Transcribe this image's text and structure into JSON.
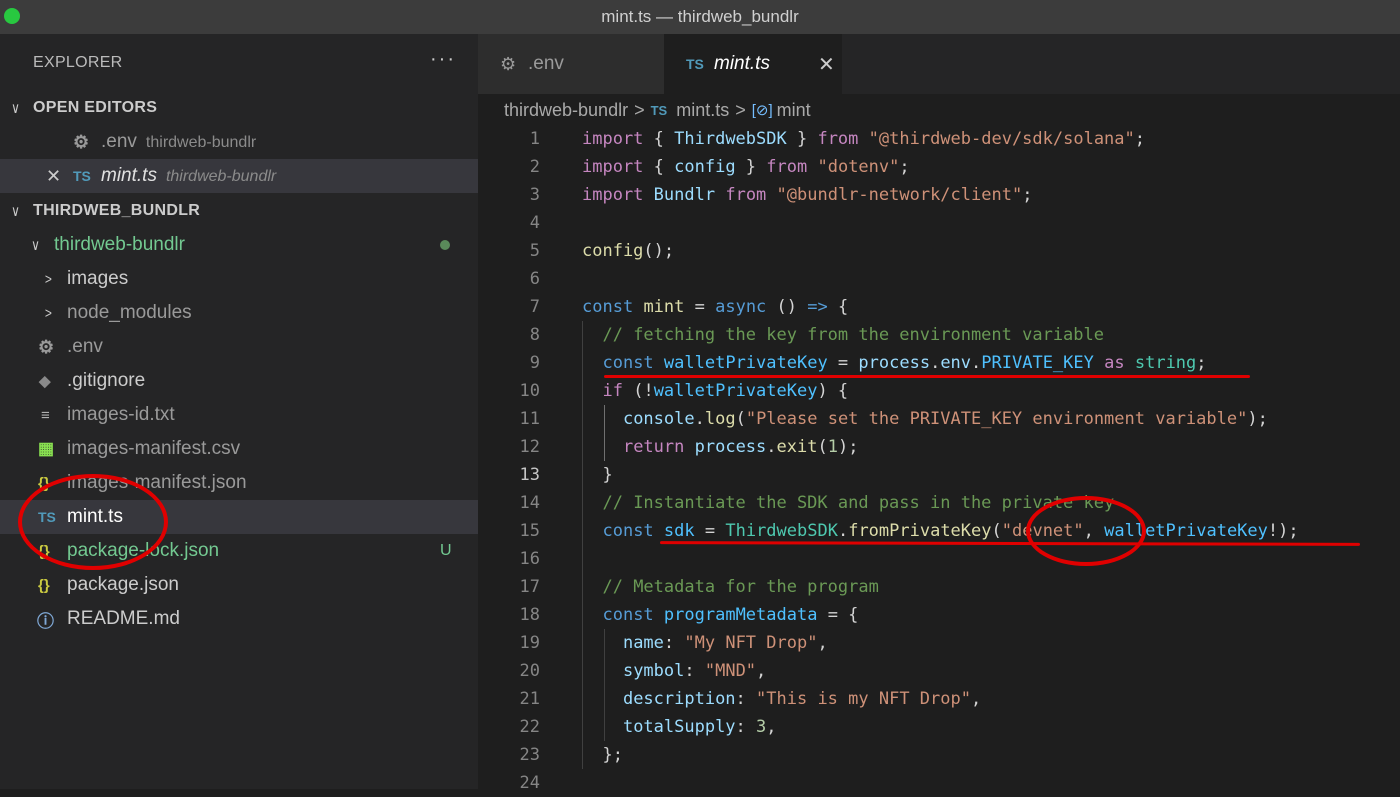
{
  "window": {
    "title": "mint.ts — thirdweb_bundlr"
  },
  "explorer": {
    "title": "EXPLORER",
    "more": "···",
    "open_editors": {
      "title": "OPEN EDITORS",
      "items": [
        {
          "icon": "gear-icon",
          "name": ".env",
          "path": "thirdweb-bundlr"
        },
        {
          "icon": "ts-icon",
          "icon_text": "TS",
          "name": "mint.ts",
          "path": "thirdweb-bundlr",
          "close": "✕"
        }
      ]
    },
    "workspace": {
      "title": "THIRDWEB_BUNDLR",
      "folder": "thirdweb-bundlr",
      "items": [
        {
          "name": "images",
          "kind": "folder"
        },
        {
          "name": "node_modules",
          "kind": "folder"
        },
        {
          "name": ".env",
          "icon": "gear-icon"
        },
        {
          "name": ".gitignore",
          "icon": "git-icon"
        },
        {
          "name": "images-id.txt",
          "icon": "lines-icon"
        },
        {
          "name": "images-manifest.csv",
          "icon": "csv-icon"
        },
        {
          "name": "images-manifest.json",
          "icon": "json-icon",
          "icon_text": "{}"
        },
        {
          "name": "mint.ts",
          "icon": "ts-icon",
          "icon_text": "TS"
        },
        {
          "name": "package-lock.json",
          "icon": "json-icon",
          "icon_text": "{}",
          "badge": "U"
        },
        {
          "name": "package.json",
          "icon": "json-icon",
          "icon_text": "{}"
        },
        {
          "name": "README.md",
          "icon": "info-icon"
        }
      ]
    }
  },
  "tabs": [
    {
      "label": ".env",
      "icon": "gear-icon"
    },
    {
      "label": "mint.ts",
      "icon": "ts-icon",
      "icon_text": "TS",
      "close": "✕",
      "active": true
    }
  ],
  "breadcrumb": {
    "folder": "thirdweb-bundlr",
    "file": "mint.ts",
    "file_icon": "TS",
    "symbol": "mint",
    "separator": ">"
  },
  "editor": {
    "current_line": 13,
    "lines": [
      [
        [
          "kw",
          "import"
        ],
        [
          "p",
          " { "
        ],
        [
          "vr",
          "ThirdwebSDK"
        ],
        [
          "p",
          " } "
        ],
        [
          "kw",
          "from"
        ],
        [
          "p",
          " "
        ],
        [
          "st",
          "\"@thirdweb-dev/sdk/solana\""
        ],
        [
          "p",
          ";"
        ]
      ],
      [
        [
          "kw",
          "import"
        ],
        [
          "p",
          " { "
        ],
        [
          "vr",
          "config"
        ],
        [
          "p",
          " } "
        ],
        [
          "kw",
          "from"
        ],
        [
          "p",
          " "
        ],
        [
          "st",
          "\"dotenv\""
        ],
        [
          "p",
          ";"
        ]
      ],
      [
        [
          "kw",
          "import"
        ],
        [
          "p",
          " "
        ],
        [
          "vr",
          "Bundlr"
        ],
        [
          "p",
          " "
        ],
        [
          "kw",
          "from"
        ],
        [
          "p",
          " "
        ],
        [
          "st",
          "\"@bundlr-network/client\""
        ],
        [
          "p",
          ";"
        ]
      ],
      [],
      [
        [
          "fn",
          "config"
        ],
        [
          "p",
          "();"
        ]
      ],
      [],
      [
        [
          "bl",
          "const"
        ],
        [
          "p",
          " "
        ],
        [
          "fn",
          "mint"
        ],
        [
          "p",
          " = "
        ],
        [
          "bl",
          "async"
        ],
        [
          "p",
          " () "
        ],
        [
          "bl",
          "=>"
        ],
        [
          "p",
          " {"
        ]
      ],
      [
        [
          "p",
          "  "
        ],
        [
          "cm",
          "// fetching the key from the environment variable"
        ]
      ],
      [
        [
          "p",
          "  "
        ],
        [
          "bl",
          "const"
        ],
        [
          "p",
          " "
        ],
        [
          "cs",
          "walletPrivateKey"
        ],
        [
          "p",
          " = "
        ],
        [
          "vr",
          "process"
        ],
        [
          "p",
          "."
        ],
        [
          "vr",
          "env"
        ],
        [
          "p",
          "."
        ],
        [
          "cs",
          "PRIVATE_KEY"
        ],
        [
          "p",
          " "
        ],
        [
          "kw",
          "as"
        ],
        [
          "p",
          " "
        ],
        [
          "ty",
          "string"
        ],
        [
          "p",
          ";"
        ]
      ],
      [
        [
          "p",
          "  "
        ],
        [
          "kw",
          "if"
        ],
        [
          "p",
          " (!"
        ],
        [
          "cs",
          "walletPrivateKey"
        ],
        [
          "p",
          ") {"
        ]
      ],
      [
        [
          "p",
          "    "
        ],
        [
          "vr",
          "console"
        ],
        [
          "p",
          "."
        ],
        [
          "fn",
          "log"
        ],
        [
          "p",
          "("
        ],
        [
          "st",
          "\"Please set the PRIVATE_KEY environment variable\""
        ],
        [
          "p",
          ");"
        ]
      ],
      [
        [
          "p",
          "    "
        ],
        [
          "kw",
          "return"
        ],
        [
          "p",
          " "
        ],
        [
          "vr",
          "process"
        ],
        [
          "p",
          "."
        ],
        [
          "fn",
          "exit"
        ],
        [
          "p",
          "("
        ],
        [
          "nm",
          "1"
        ],
        [
          "p",
          ");"
        ]
      ],
      [
        [
          "p",
          "  }"
        ]
      ],
      [
        [
          "p",
          "  "
        ],
        [
          "cm",
          "// Instantiate the SDK and pass in the private key"
        ]
      ],
      [
        [
          "p",
          "  "
        ],
        [
          "bl",
          "const"
        ],
        [
          "p",
          " "
        ],
        [
          "cs",
          "sdk"
        ],
        [
          "p",
          " = "
        ],
        [
          "ty",
          "ThirdwebSDK"
        ],
        [
          "p",
          "."
        ],
        [
          "fn",
          "fromPrivateKey"
        ],
        [
          "p",
          "("
        ],
        [
          "st",
          "\"devnet\""
        ],
        [
          "p",
          ", "
        ],
        [
          "cs",
          "walletPrivateKey"
        ],
        [
          "p",
          "!);"
        ]
      ],
      [],
      [
        [
          "p",
          "  "
        ],
        [
          "cm",
          "// Metadata for the program"
        ]
      ],
      [
        [
          "p",
          "  "
        ],
        [
          "bl",
          "const"
        ],
        [
          "p",
          " "
        ],
        [
          "cs",
          "programMetadata"
        ],
        [
          "p",
          " = {"
        ]
      ],
      [
        [
          "p",
          "    "
        ],
        [
          "vr",
          "name"
        ],
        [
          "p",
          ": "
        ],
        [
          "st",
          "\"My NFT Drop\""
        ],
        [
          "p",
          ","
        ]
      ],
      [
        [
          "p",
          "    "
        ],
        [
          "vr",
          "symbol"
        ],
        [
          "p",
          ": "
        ],
        [
          "st",
          "\"MND\""
        ],
        [
          "p",
          ","
        ]
      ],
      [
        [
          "p",
          "    "
        ],
        [
          "vr",
          "description"
        ],
        [
          "p",
          ": "
        ],
        [
          "st",
          "\"This is my NFT Drop\""
        ],
        [
          "p",
          ","
        ]
      ],
      [
        [
          "p",
          "    "
        ],
        [
          "vr",
          "totalSupply"
        ],
        [
          "p",
          ": "
        ],
        [
          "nm",
          "3"
        ],
        [
          "p",
          ","
        ]
      ],
      [
        [
          "p",
          "  };"
        ]
      ],
      []
    ]
  },
  "colors": {
    "annotation": "#e00000",
    "ts": "#519aba",
    "untracked": "#73c991"
  }
}
